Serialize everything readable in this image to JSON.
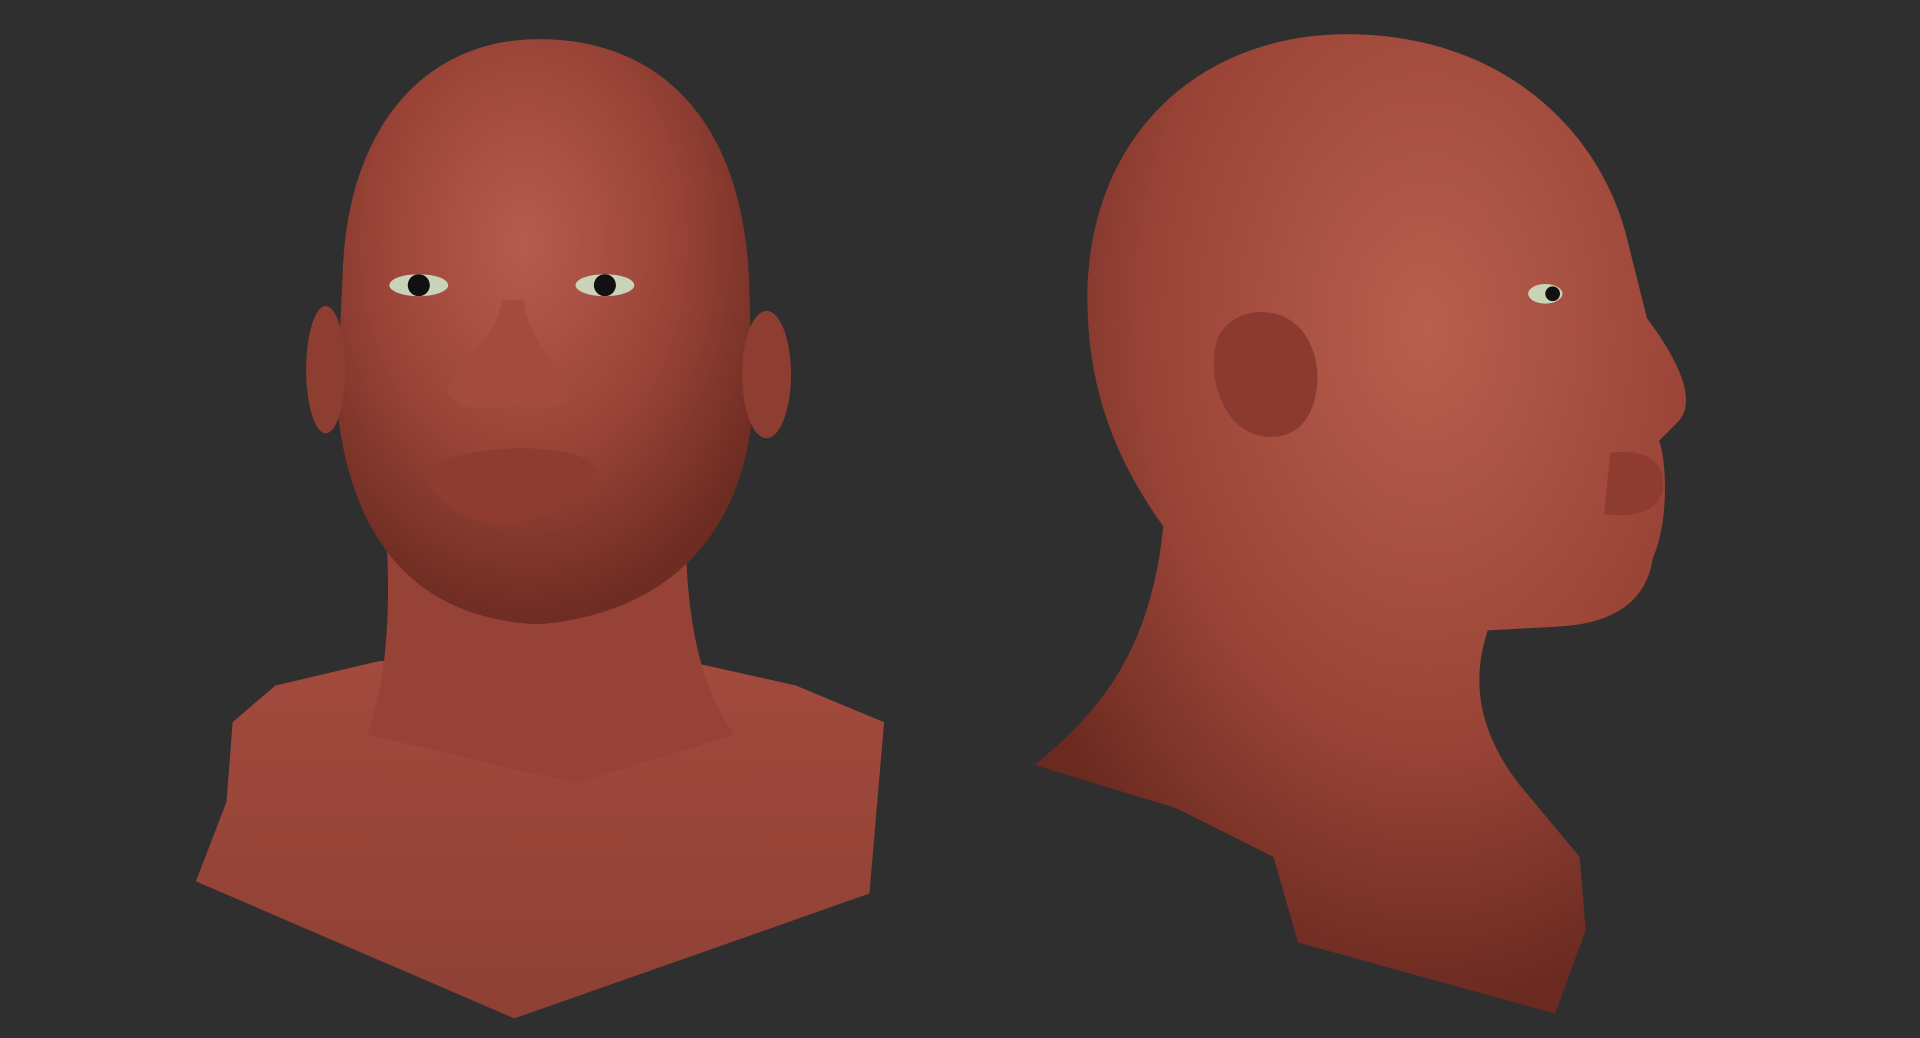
{
  "scene": {
    "description_free": true,
    "colors": {
      "background": "#2f2f2f",
      "skin_highlight": "#b65c4e",
      "skin_mid": "#9a4437",
      "skin_shadow": "#6e2c22",
      "eye_white": "#c9d3b8",
      "pupil": "#111111"
    },
    "views": [
      "front",
      "profile-right"
    ]
  }
}
